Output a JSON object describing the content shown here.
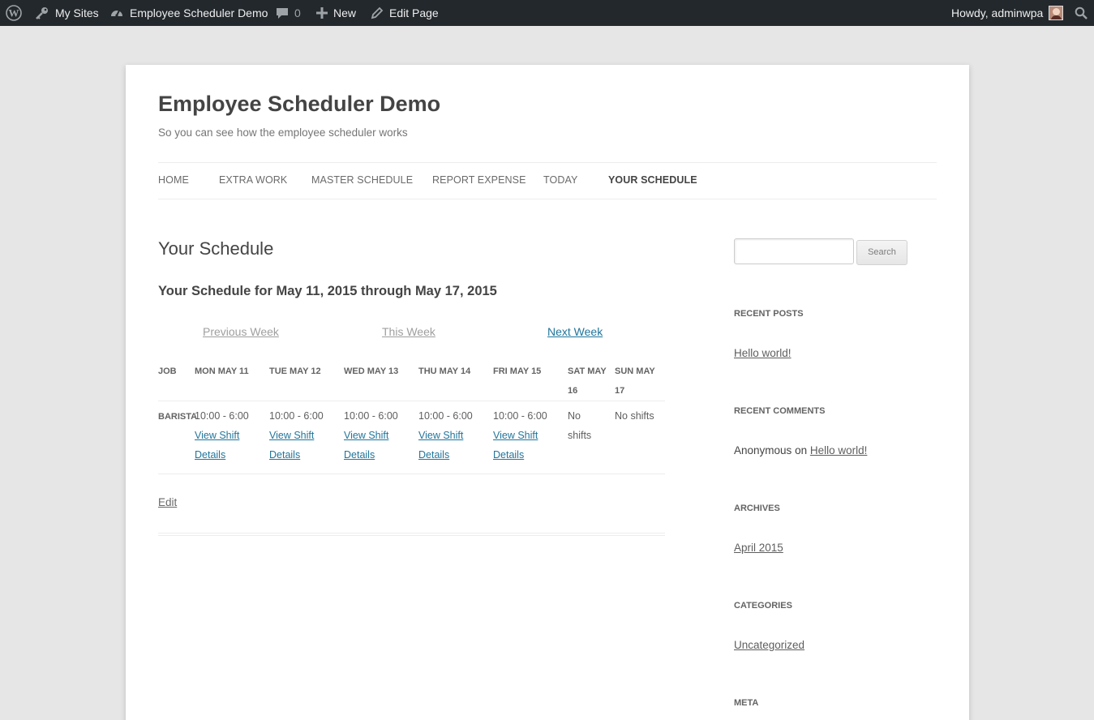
{
  "adminbar": {
    "wp_logo": "wordpress-icon",
    "my_sites": "My Sites",
    "site_name": "Employee Scheduler Demo",
    "comments_count": "0",
    "new_label": "New",
    "edit_page_label": "Edit Page",
    "howdy": "Howdy, adminwpa"
  },
  "site": {
    "title": "Employee Scheduler Demo",
    "description": "So you can see how the employee scheduler works"
  },
  "nav": {
    "items": [
      {
        "label": "HOME"
      },
      {
        "label": "EXTRA WORK"
      },
      {
        "label": "MASTER SCHEDULE"
      },
      {
        "label": "REPORT EXPENSE"
      },
      {
        "label": "TODAY"
      },
      {
        "label": "YOUR SCHEDULE"
      }
    ]
  },
  "main": {
    "page_title": "Your Schedule",
    "schedule_heading": "Your Schedule for May 11, 2015 through May 17, 2015",
    "week_nav": {
      "previous": "Previous Week",
      "this": "This Week",
      "next": "Next Week"
    },
    "table": {
      "headers": [
        "JOB",
        "MON MAY 11",
        "TUE MAY 12",
        "WED MAY 13",
        "THU MAY 14",
        "FRI MAY 15",
        "SAT MAY 16",
        "SUN MAY 17"
      ],
      "row": {
        "job": "BARISTA",
        "cells": [
          {
            "time": "10:00 - 6:00",
            "link": "View Shift Details"
          },
          {
            "time": "10:00 - 6:00",
            "link": "View Shift Details"
          },
          {
            "time": "10:00 - 6:00",
            "link": "View Shift Details"
          },
          {
            "time": "10:00 - 6:00",
            "link": "View Shift Details"
          },
          {
            "time": "10:00 - 6:00",
            "link": "View Shift Details"
          },
          {
            "text": "No shifts"
          },
          {
            "text": "No shifts"
          }
        ]
      }
    },
    "edit_link": "Edit"
  },
  "sidebar": {
    "search_button": "Search",
    "search_placeholder": "",
    "recent_posts": {
      "title": "RECENT POSTS",
      "items": [
        "Hello world!"
      ]
    },
    "recent_comments": {
      "title": "RECENT COMMENTS",
      "author": "Anonymous",
      "on": "on",
      "post": "Hello world!"
    },
    "archives": {
      "title": "ARCHIVES",
      "items": [
        "April 2015"
      ]
    },
    "categories": {
      "title": "CATEGORIES",
      "items": [
        "Uncategorized"
      ]
    },
    "meta": {
      "title": "META"
    }
  },
  "colors": {
    "adminbar_bg": "#23282d",
    "link": "#21759b",
    "page_bg": "#e6e6e6"
  }
}
